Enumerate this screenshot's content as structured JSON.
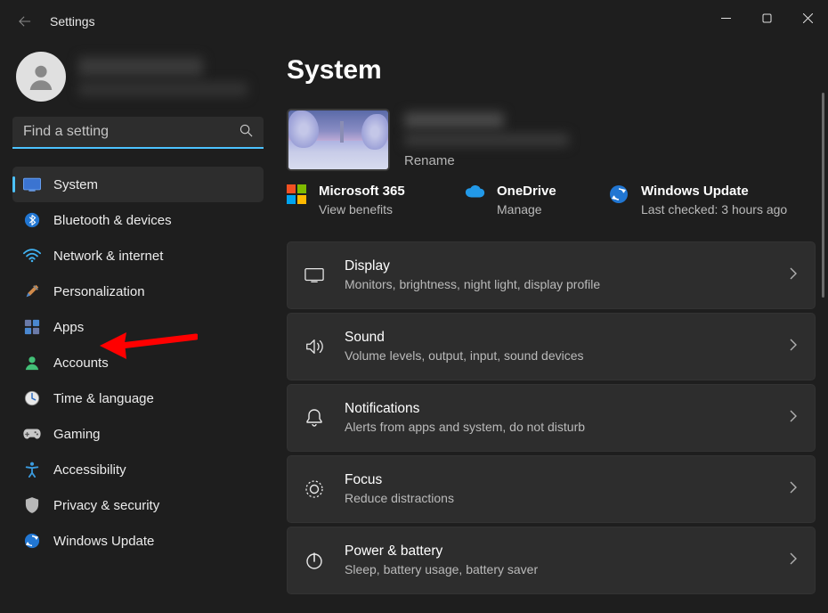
{
  "window": {
    "title": "Settings"
  },
  "search": {
    "placeholder": "Find a setting"
  },
  "nav": [
    {
      "label": "System"
    },
    {
      "label": "Bluetooth & devices"
    },
    {
      "label": "Network & internet"
    },
    {
      "label": "Personalization"
    },
    {
      "label": "Apps"
    },
    {
      "label": "Accounts"
    },
    {
      "label": "Time & language"
    },
    {
      "label": "Gaming"
    },
    {
      "label": "Accessibility"
    },
    {
      "label": "Privacy & security"
    },
    {
      "label": "Windows Update"
    }
  ],
  "main": {
    "title": "System",
    "device": {
      "rename": "Rename"
    },
    "status": {
      "m365": {
        "title": "Microsoft 365",
        "sub": "View benefits"
      },
      "onedrive": {
        "title": "OneDrive",
        "sub": "Manage"
      },
      "update": {
        "title": "Windows Update",
        "sub": "Last checked: 3 hours ago"
      }
    },
    "cards": [
      {
        "title": "Display",
        "sub": "Monitors, brightness, night light, display profile"
      },
      {
        "title": "Sound",
        "sub": "Volume levels, output, input, sound devices"
      },
      {
        "title": "Notifications",
        "sub": "Alerts from apps and system, do not disturb"
      },
      {
        "title": "Focus",
        "sub": "Reduce distractions"
      },
      {
        "title": "Power & battery",
        "sub": "Sleep, battery usage, battery saver"
      }
    ]
  }
}
